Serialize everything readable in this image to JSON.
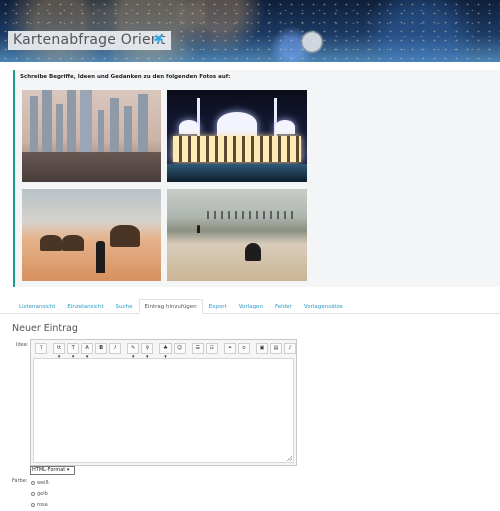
{
  "header": {
    "title": "Kartenabfrage Orient",
    "settings_icon": "gear-icon"
  },
  "intro": {
    "instruction": "Schreibe Begriffe, Ideen und Gedanken zu den folgenden Fotos auf:",
    "accent_color": "#1f9d8a"
  },
  "tabs": [
    {
      "label": "Listenansicht"
    },
    {
      "label": "Einzelansicht"
    },
    {
      "label": "Suche"
    },
    {
      "label": "Eintrag hinzufügen"
    },
    {
      "label": "Export"
    },
    {
      "label": "Vorlagen"
    },
    {
      "label": "Felder"
    },
    {
      "label": "Vorlagensätze"
    }
  ],
  "active_tab": "Eintrag hinzufügen",
  "form": {
    "title": "Neuer Eintrag",
    "idea_label": "Idee:",
    "format_select": "HTML-Format",
    "color_label": "Farbe:",
    "color_options": [
      "weiß",
      "gelb",
      "rosa"
    ]
  },
  "toolbar": {
    "buttons": [
      "⅂",
      "tt ▾",
      "T ▾",
      "A ▾",
      "B",
      "I",
      "✎ ▾",
      "♀ ▾",
      "♣ ▾",
      "☺",
      "☰",
      "☷",
      "⚭",
      "⦸",
      "▣",
      "▤",
      "♪"
    ]
  },
  "link_color": "#2a9bc7"
}
